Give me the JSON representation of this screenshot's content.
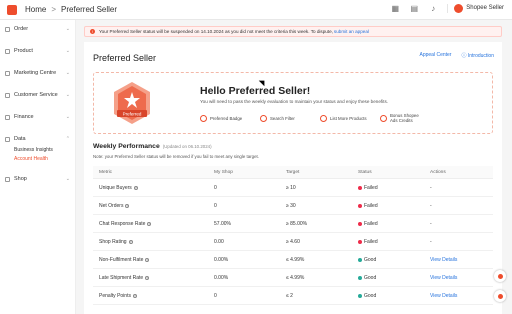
{
  "header": {
    "breadcrumb_home": "Home",
    "breadcrumb_separator": ">",
    "breadcrumb_current": "Preferred Seller",
    "store_name": "Shopee Seller",
    "icons": [
      "grid-icon",
      "book-icon",
      "bell-icon"
    ]
  },
  "sidebar": {
    "items": [
      {
        "label": "Order",
        "icon": "order-icon"
      },
      {
        "label": "Product",
        "icon": "product-icon"
      },
      {
        "label": "Marketing Centre",
        "icon": "marketing-icon"
      },
      {
        "label": "Customer Service",
        "icon": "customer-service-icon"
      },
      {
        "label": "Finance",
        "icon": "finance-icon"
      },
      {
        "label": "Data",
        "icon": "data-icon"
      },
      {
        "label": "Shop",
        "icon": "shop-icon"
      }
    ],
    "data_subitems": [
      "Business Insights",
      "Account Health"
    ]
  },
  "alert": {
    "text": "Your Preferred Seller status will be suspended on 14.10.2024 as you did not meet the criteria this week. To dispute,",
    "link": "submit an appeal"
  },
  "page": {
    "title": "Preferred Seller",
    "links": [
      "Appeal Center",
      "Introduction"
    ]
  },
  "banner": {
    "badge_label": "Preferred",
    "heading": "Hello Preferred Seller!",
    "subtext": "You will need to pass the weekly evaluation to maintain your status and enjoy these benefits.",
    "benefits": [
      "Preferred Badge",
      "Search Filter",
      "List More Products",
      "Bonus Shopee Ads Credits"
    ]
  },
  "weekly": {
    "title": "Weekly Performance",
    "updated": "(Updated on 06.10.2024)",
    "note": "Note: your Preferred Seller status will be removed if you fail to meet any single target."
  },
  "table": {
    "headers": [
      "Metric",
      "My Shop",
      "Target",
      "Status",
      "Actions"
    ],
    "rows": [
      {
        "metric": "Unique Buyers",
        "my_shop": "0",
        "target": "≥ 10",
        "status": "Failed",
        "status_type": "failed",
        "action": "-"
      },
      {
        "metric": "Net Orders",
        "my_shop": "0",
        "target": "≥ 30",
        "status": "Failed",
        "status_type": "failed",
        "action": "-"
      },
      {
        "metric": "Chat Response Rate",
        "my_shop": "57.00%",
        "target": "≥ 85.00%",
        "status": "Failed",
        "status_type": "failed",
        "action": "-"
      },
      {
        "metric": "Shop Rating",
        "my_shop": "0.00",
        "target": "≥ 4.60",
        "status": "Failed",
        "status_type": "failed",
        "action": "-"
      },
      {
        "metric": "Non-Fulfilment Rate",
        "my_shop": "0.00%",
        "target": "≤ 4.99%",
        "status": "Good",
        "status_type": "good",
        "action": "View Details"
      },
      {
        "metric": "Late Shipment Rate",
        "my_shop": "0.00%",
        "target": "≤ 4.99%",
        "status": "Good",
        "status_type": "good",
        "action": "View Details"
      },
      {
        "metric": "Penalty Points",
        "my_shop": "0",
        "target": "≤ 2",
        "status": "Good",
        "status_type": "good",
        "action": "View Details"
      }
    ]
  },
  "colors": {
    "brand": "#ee4d2d",
    "failed": "#ee2c4a",
    "good": "#26aa99",
    "link": "#2673dd"
  }
}
